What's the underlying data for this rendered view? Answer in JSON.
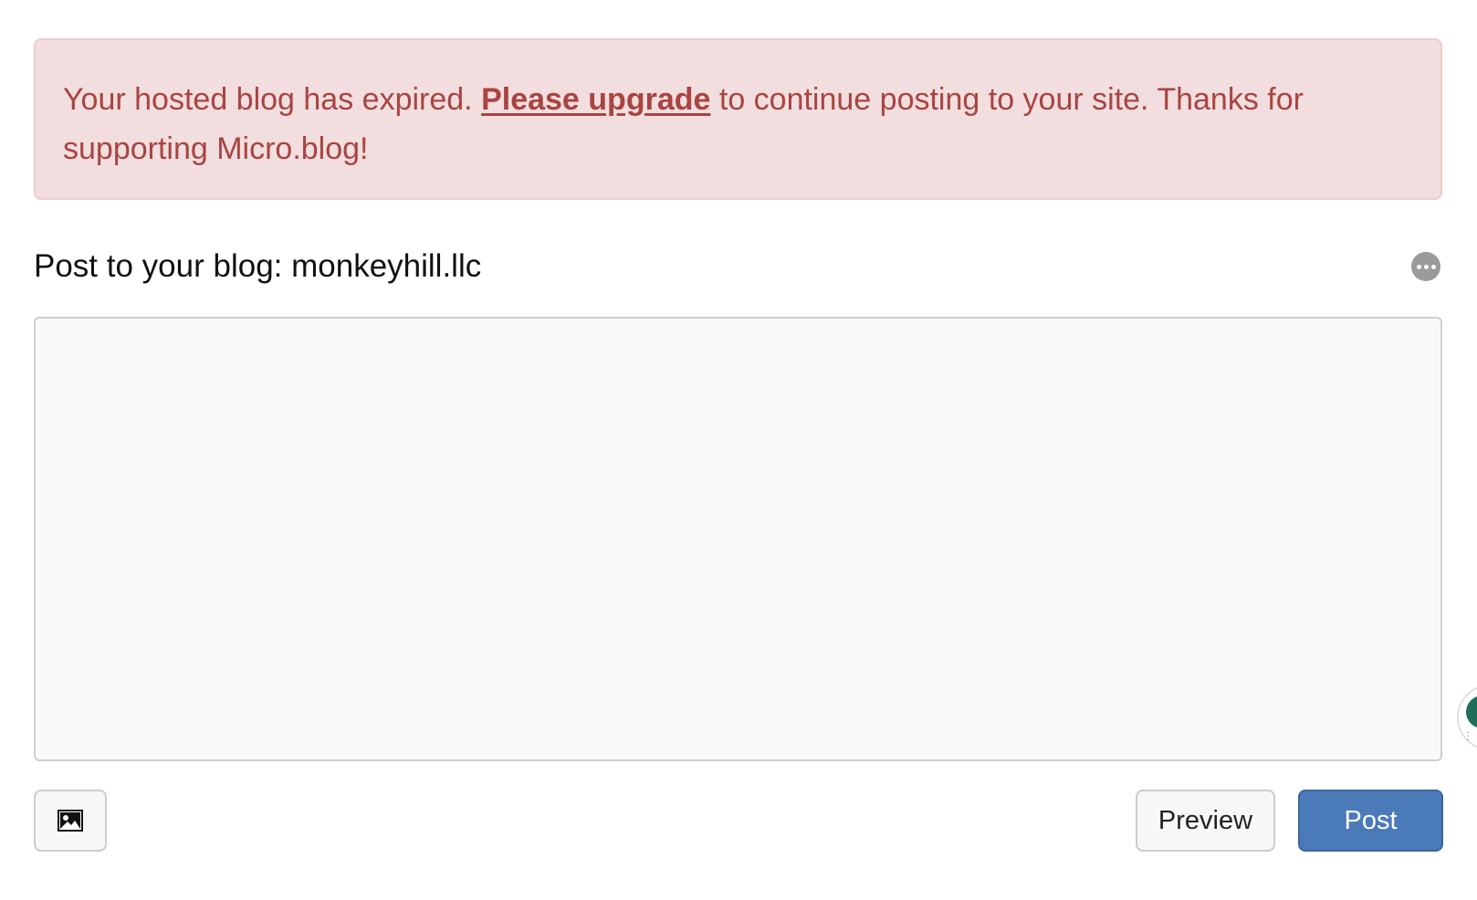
{
  "alert": {
    "text_before": "Your hosted blog has expired. ",
    "link_label": "Please upgrade",
    "text_after": " to continue posting to your site. Thanks for supporting Micro.blog!",
    "background_color": "#f2dede",
    "text_color": "#a94442"
  },
  "post_header": {
    "label": "Post to your blog: ",
    "blog_name": "monkeyhill.llc"
  },
  "editor": {
    "value": "",
    "placeholder": ""
  },
  "toolbar": {
    "image_button_icon": "image-icon",
    "more_button_icon": "more-options-icon",
    "preview_label": "Preview",
    "post_label": "Post",
    "post_button_color": "#4a7ab8"
  }
}
